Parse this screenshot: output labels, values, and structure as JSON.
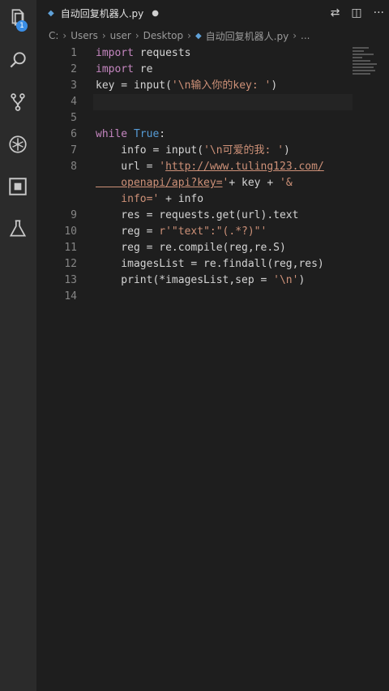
{
  "tab": {
    "filename": "自动回复机器人.py",
    "dirty_indicator": "●"
  },
  "breadcrumb": [
    "C:",
    "Users",
    "user",
    "Desktop",
    "自动回复机器人.py",
    "..."
  ],
  "activity_badge": "1",
  "line_numbers": [
    "1",
    "2",
    "3",
    "4",
    "5",
    "6",
    "7",
    "8",
    "",
    "",
    "9",
    "10",
    "11",
    "12",
    "13",
    "14"
  ],
  "code": {
    "l1_kw": "import",
    "l1_rest": " requests",
    "l2_kw": "import",
    "l2_rest": " re",
    "l3_a": "key = input(",
    "l3_str": "'\\n输入你的key: '",
    "l3_b": ")",
    "l6_kw": "while",
    "l6_sp": " ",
    "l6_bool": "True",
    "l6_c": ":",
    "l7_a": "    info = input(",
    "l7_str": "'\\n可爱的我: '",
    "l7_b": ")",
    "l8_a": "    url = ",
    "l8_q": "'",
    "l8_url": "http://www.tuling123.com/",
    "l8b_url": "    openapi/api?key=",
    "l8b_q": "'",
    "l8b_rest": "+ key + ",
    "l8b_str": "'&",
    "l8c_str": "    info='",
    "l8c_rest": " + info",
    "l9": "    res = requests.get(url).text",
    "l10_a": "    reg = ",
    "l10_str": "r'\"text\":\"(.*?)\"'",
    "l11": "    reg = re.compile(reg,re.S)",
    "l12": "    imagesList = re.findall(reg,res)",
    "l13_a": "    print(*imagesList,sep = ",
    "l13_str": "'\\n'",
    "l13_b": ")"
  },
  "colors": {
    "keyword": "#c586c0",
    "bool": "#569cd6",
    "string": "#ce9178",
    "text": "#d4d4d4"
  }
}
